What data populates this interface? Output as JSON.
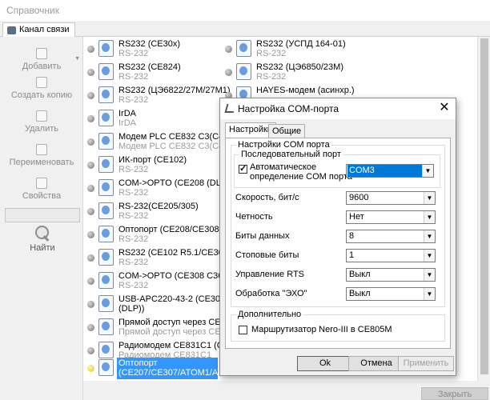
{
  "window": {
    "title": "Справочник"
  },
  "tab": {
    "label": "Канал связи"
  },
  "toolbar": {
    "add": "Добавить",
    "copy": "Создать копию",
    "delete": "Удалить",
    "rename": "Переименовать",
    "properties": "Свойства",
    "find": "Найти",
    "search_value": ""
  },
  "list": {
    "left": [
      {
        "name": "RS232 (CE30x)",
        "sub": "RS-232"
      },
      {
        "name": "RS232 (CE824)",
        "sub": "RS-232"
      },
      {
        "name": "RS232 (ЦЭ6822/27М/27М1)",
        "sub": "RS-232"
      },
      {
        "name": "IrDA",
        "sub": "IrDA"
      },
      {
        "name": "Модем PLC CE832 C3(C4)",
        "sub": "Модем PLC CE832 C3(C4)"
      },
      {
        "name": "ИК-порт (CE102)",
        "sub": "RS-232"
      },
      {
        "name": "COM->OPTO (CE208 (DLP))",
        "sub": "RS-232"
      },
      {
        "name": "RS-232(CE205/305)",
        "sub": "RS-232"
      },
      {
        "name": "Оптопорт (CE208/CE308 (SMP))",
        "sub": "RS-232"
      },
      {
        "name": "RS232 (CE102 R5.1/CE307)",
        "sub": "RS-232"
      },
      {
        "name": "COM->OPTO (CE308 C36 (DLP))",
        "sub": "RS-232"
      },
      {
        "name": "USB-APC220-43-2 (CE308 C36",
        "sub": "(DLP))"
      },
      {
        "name": "Прямой доступ через CE805M",
        "sub": "Прямой доступ через CE805M"
      },
      {
        "name": "Радиомодем CE831C1 (CE208)",
        "sub": "Радиомодем CE831C1"
      },
      {
        "name": "Оптопорт",
        "sub": "(CE207/CE307/ATOM1/ATOM..."
      }
    ],
    "right": [
      {
        "name": "RS232 (УСПД 164-01)",
        "sub": "RS-232"
      },
      {
        "name": "RS232 (ЦЭ6850/23М)",
        "sub": "RS-232"
      },
      {
        "name": "HAYES-модем (асинхр.)",
        "sub": ""
      }
    ],
    "selected_index": 14
  },
  "bottom": {
    "close": "Закрыть"
  },
  "dialog": {
    "title": "Настройка COM-порта",
    "tabs": [
      "Настройки",
      "Общие"
    ],
    "group_main": "Настройки COM порта",
    "group_serial": "Последовательный порт",
    "auto_detect_label_1": "Автоматическое",
    "auto_detect_label_2": "определение COM порта",
    "auto_detect_checked": true,
    "port_value": "COM3",
    "fields": [
      {
        "label": "Скорость, бит/с",
        "value": "9600"
      },
      {
        "label": "Четность",
        "value": "Нет"
      },
      {
        "label": "Биты данных",
        "value": "8"
      },
      {
        "label": "Стоповые биты",
        "value": "1"
      },
      {
        "label": "Управление RTS",
        "value": "Выкл"
      },
      {
        "label": "Обработка \"ЭХО\"",
        "value": "Выкл"
      }
    ],
    "group_extra": "Дополнительно",
    "router_label": "Маршрутизатор Nero-III в CE805M",
    "router_checked": false,
    "ok": "Ok",
    "cancel": "Отмена",
    "apply": "Применить"
  }
}
